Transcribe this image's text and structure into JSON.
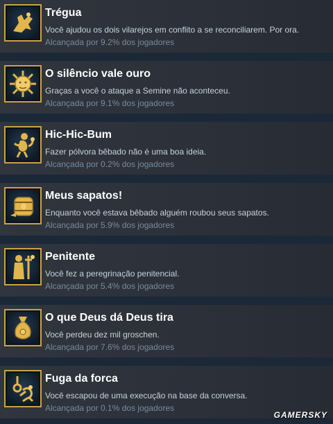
{
  "achievements": [
    {
      "title": "Trégua",
      "description": "Você ajudou os dois vilarejos em conflito a se reconciliarem. Por ora.",
      "stat": "Alcançada por 9.2% dos jogadores",
      "icon": "truce-icon"
    },
    {
      "title": "O silêncio vale ouro",
      "description": "Graças a você o ataque a Semine não aconteceu.",
      "stat": "Alcançada por 9.1% dos jogadores",
      "icon": "sun-face-icon"
    },
    {
      "title": "Hic-Hic-Bum",
      "description": "Fazer pólvora bêbado não é uma boa ideia.",
      "stat": "Alcançada por 0.2% dos jogadores",
      "icon": "drunk-figure-icon"
    },
    {
      "title": "Meus sapatos!",
      "description": "Enquanto você estava bêbado alguém roubou seus sapatos.",
      "stat": "Alcançada por 5.9% dos jogadores",
      "icon": "barrel-icon"
    },
    {
      "title": "Penitente",
      "description": "Você fez a peregrinação penitencial.",
      "stat": "Alcançada por 5.4% dos jogadores",
      "icon": "pilgrim-icon"
    },
    {
      "title": "O que Deus dá Deus tira",
      "description": "Você perdeu dez mil groschen.",
      "stat": "Alcançada por 7.6% dos jogadores",
      "icon": "money-pouch-icon"
    },
    {
      "title": "Fuga da forca",
      "description": "Você escapou de uma execução na base da conversa.",
      "stat": "Alcançada por 0.1% dos jogadores",
      "icon": "noose-icon"
    }
  ],
  "watermark": "GAMERSKY"
}
